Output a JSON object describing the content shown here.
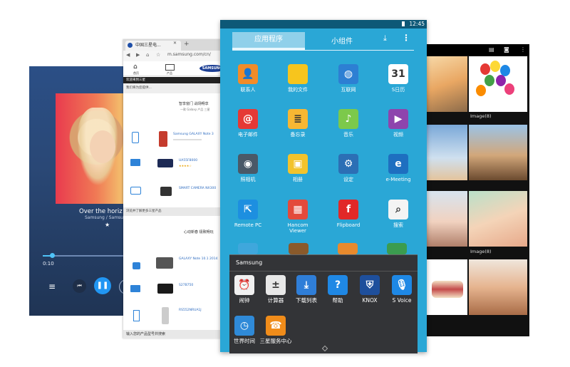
{
  "music": {
    "song": "Over the horiz",
    "artist": "Samsung / Samsu",
    "time": "0:10",
    "icons": [
      "playlist-icon",
      "previous-icon",
      "pause-icon",
      "next-icon",
      "star-icon"
    ],
    "accent": "#2196f3"
  },
  "browser": {
    "tab_title": "中国三星电...",
    "url": "m.samsung.com/cn/",
    "logo": "SAMSUNG",
    "nav_labels": [
      "首页",
      "产品"
    ],
    "header_bar": "我们将为您提供...",
    "welcome": "欢迎来到三星",
    "section1_title": "智享窗门 战场畅享",
    "section1_sub": "一款 Galaxy 产品 三星",
    "product_1": "Samsung GALAXY Note 3",
    "product_2": "UA55F8000",
    "product_3": "SMART CAMERA NX300",
    "middle_bar": "浏览并了解更多三星产品",
    "section2_title": "心动新春 极致畅玩",
    "product_4": "GALAXY Note 10.1 2014",
    "product_5": "S27B750",
    "product_6": "RS552NRUA1J",
    "footer": "输入您的产品型号并搜索"
  },
  "tablet": {
    "time": "12:45",
    "tab_apps": "应用程序",
    "tab_widgets": "小组件",
    "apps": [
      {
        "label": "联系人",
        "icon": "contacts-icon",
        "color": "#f28c28"
      },
      {
        "label": "我的文件",
        "icon": "folder-icon",
        "color": "#f7c51d"
      },
      {
        "label": "互联网",
        "icon": "globe-icon",
        "color": "#2d7fd3"
      },
      {
        "label": "S日历",
        "icon": "calendar-icon",
        "color": "#ffffff"
      },
      {
        "label": "电子邮件",
        "icon": "email-icon",
        "color": "#e53935"
      },
      {
        "label": "备忘录",
        "icon": "memo-icon",
        "color": "#f7b733"
      },
      {
        "label": "音乐",
        "icon": "music-icon",
        "color": "#7cc94b"
      },
      {
        "label": "视频",
        "icon": "video-icon",
        "color": "#8e44ad"
      },
      {
        "label": "照相机",
        "icon": "camera-icon",
        "color": "#4a5968"
      },
      {
        "label": "相册",
        "icon": "gallery-icon",
        "color": "#f2c32c"
      },
      {
        "label": "设定",
        "icon": "settings-icon",
        "color": "#2c6fb5"
      },
      {
        "label": "e-Meeting",
        "icon": "emeeting-icon",
        "color": "#1e6fc0"
      },
      {
        "label": "Remote PC",
        "icon": "remote-pc-icon",
        "color": "#1d8fe0"
      },
      {
        "label": "Hancom\nViewer",
        "icon": "hancom-icon",
        "color": "#e34a3b"
      },
      {
        "label": "Flipboard",
        "icon": "flipboard-icon",
        "color": "#e12828"
      },
      {
        "label": "搜索",
        "icon": "search-icon",
        "color": "#f4f4f4"
      }
    ],
    "folder": {
      "title": "Samsung",
      "apps": [
        {
          "label": "闹钟",
          "icon": "alarm-icon",
          "color": "#f0f0f0"
        },
        {
          "label": "计算器",
          "icon": "calculator-icon",
          "color": "#e8e8e8"
        },
        {
          "label": "下载列表",
          "icon": "download-icon",
          "color": "#2f7ed8"
        },
        {
          "label": "帮助",
          "icon": "help-icon",
          "color": "#1f88e5"
        },
        {
          "label": "KNOX",
          "icon": "knox-icon",
          "color": "#1e4f9c"
        },
        {
          "label": "S Voice",
          "icon": "voice-icon",
          "color": "#1e88e5"
        },
        {
          "label": "世界时间",
          "icon": "world-clock-icon",
          "color": "#2f8ad8"
        },
        {
          "label": "三星服务中心",
          "icon": "service-center-icon",
          "color": "#f08c1a"
        }
      ]
    }
  },
  "gallery": {
    "captions": [
      "Image(8)",
      "Image(8)"
    ],
    "icons": [
      "slideshow-icon",
      "camera-icon",
      "more-icon"
    ]
  }
}
